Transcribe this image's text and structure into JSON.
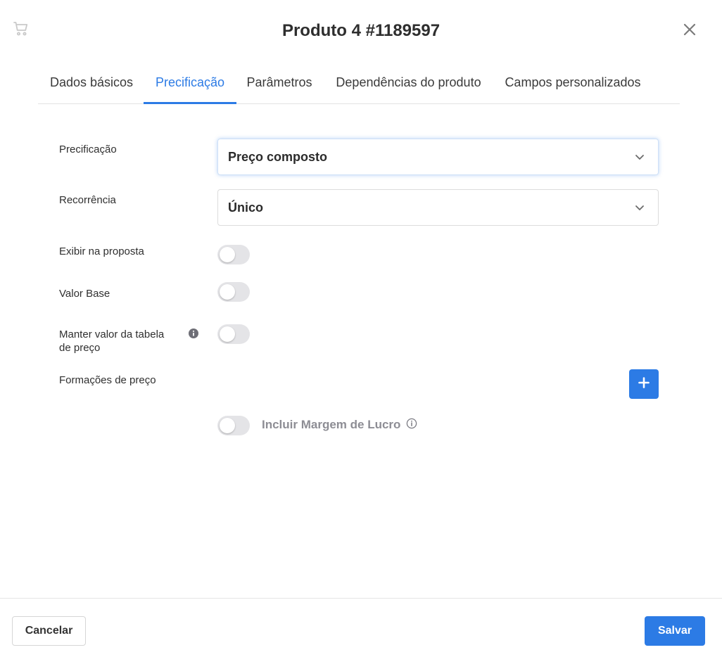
{
  "modal": {
    "title": "Produto 4 #1189597",
    "icon": "cart-icon",
    "close_icon": "close-icon"
  },
  "tabs": [
    {
      "label": "Dados básicos",
      "active": false
    },
    {
      "label": "Precificação",
      "active": true
    },
    {
      "label": "Parâmetros",
      "active": false
    },
    {
      "label": "Dependências do produto",
      "active": false
    },
    {
      "label": "Campos personalizados",
      "active": false
    }
  ],
  "form": {
    "pricing": {
      "label": "Precificação",
      "value": "Preço composto"
    },
    "recurrence": {
      "label": "Recorrência",
      "value": "Único"
    },
    "show_in_proposal": {
      "label": "Exibir na proposta",
      "on": false
    },
    "base_value": {
      "label": "Valor Base",
      "on": false
    },
    "keep_table_value": {
      "label": "Manter valor da tabela de preço",
      "on": false
    },
    "price_formations": {
      "label": "Formações de preço"
    },
    "profit_margin": {
      "label": "Incluir Margem de Lucro",
      "on": false
    }
  },
  "footer": {
    "cancel_label": "Cancelar",
    "save_label": "Salvar"
  },
  "colors": {
    "accent": "#2c7be5",
    "toggle_off": "#e4e4e7"
  }
}
